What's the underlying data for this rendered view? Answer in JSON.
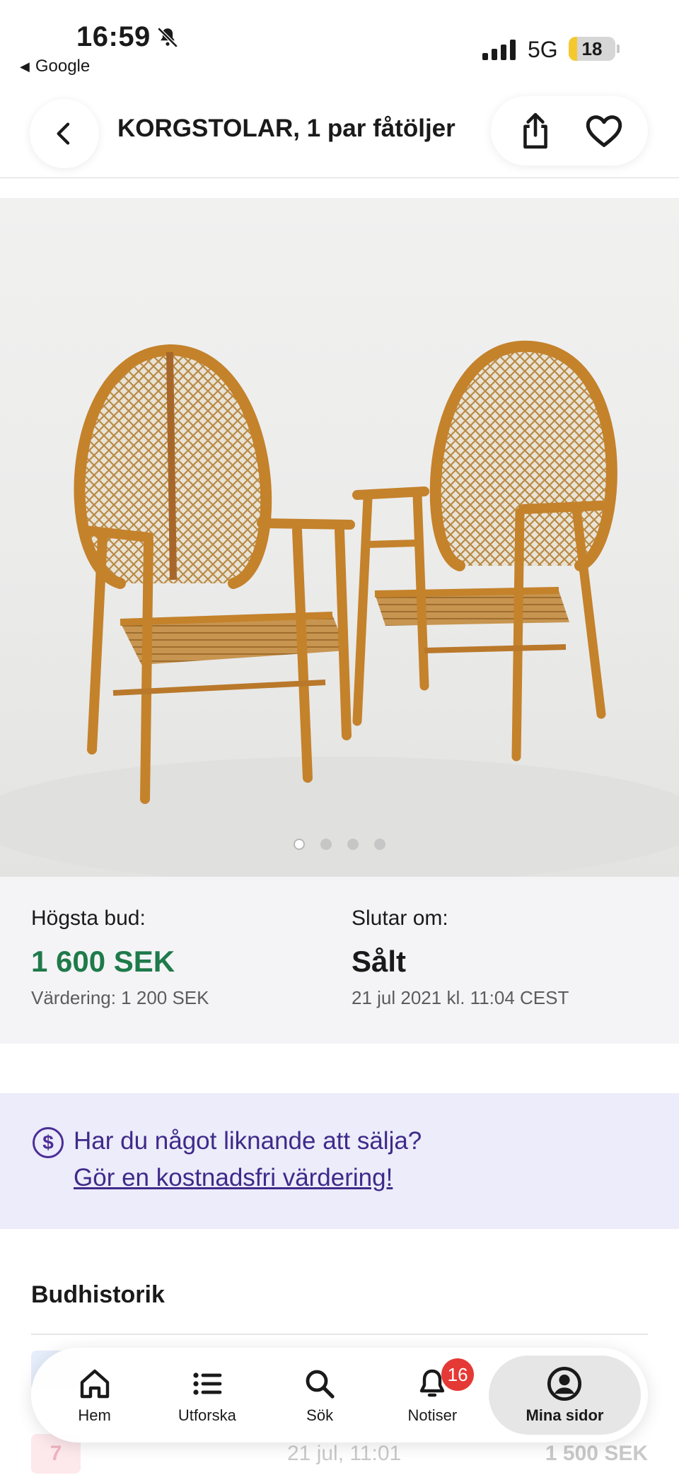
{
  "status_bar": {
    "time": "16:59",
    "back_app": "Google",
    "network": "5G",
    "battery": "18",
    "battery_level": 0.18
  },
  "header": {
    "title": "KORGSTOLAR, 1 par fåtöljer",
    "icons": [
      "chevron-left-icon",
      "share-icon",
      "heart-icon"
    ]
  },
  "gallery": {
    "image_count": 4,
    "active_index": 0
  },
  "bid": {
    "highest_label": "Högsta bud:",
    "highest_value": "1 600 SEK",
    "valuation": "Värdering: 1 200 SEK",
    "ends_label": "Slutar om:",
    "ends_value": "Sålt",
    "ends_date": "21 jul 2021 kl. 11:04 CEST"
  },
  "promo": {
    "question": "Har du något liknande att sälja?",
    "link": "Gör en kostnadsfri värdering!"
  },
  "history": {
    "title": "Budhistorik",
    "rows": [
      {
        "bidder": "",
        "date": "",
        "amount": ""
      },
      {
        "bidder": "7",
        "date": "21 jul, 11:01",
        "amount": "1 500 SEK"
      }
    ]
  },
  "bottom_nav": {
    "items": [
      {
        "label": "Hem",
        "icon": "home-icon"
      },
      {
        "label": "Utforska",
        "icon": "list-icon"
      },
      {
        "label": "Sök",
        "icon": "search-icon"
      },
      {
        "label": "Notiser",
        "icon": "bell-icon",
        "badge": "16"
      },
      {
        "label": "Mina sidor",
        "icon": "user-icon",
        "active": true
      }
    ]
  },
  "colors": {
    "price_green": "#1f7a4a",
    "promo_purple": "#3f2a8a",
    "promo_bg": "#ececfa",
    "badge_red": "#e53935"
  }
}
